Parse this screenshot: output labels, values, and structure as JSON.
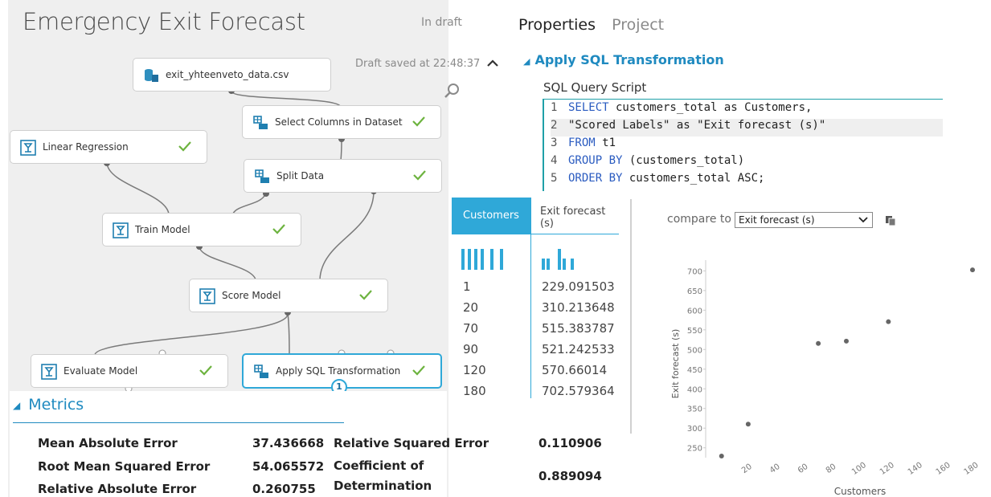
{
  "experiment": {
    "title": "Emergency Exit Forecast",
    "status": "In draft",
    "saved_at": "Draft saved at 22:48:37"
  },
  "nodes": {
    "dataset": {
      "label": "exit_yhteenveto_data.csv"
    },
    "select_columns": {
      "label": "Select Columns in Dataset"
    },
    "linear_regression": {
      "label": "Linear Regression"
    },
    "split_data": {
      "label": "Split Data"
    },
    "train_model": {
      "label": "Train Model"
    },
    "score_model": {
      "label": "Score Model"
    },
    "evaluate_model": {
      "label": "Evaluate Model"
    },
    "apply_sql": {
      "label": "Apply SQL Transformation",
      "badge": "1"
    }
  },
  "metrics": {
    "header": "Metrics",
    "rows_left": [
      {
        "label": "Mean Absolute Error",
        "value": "37.436668"
      },
      {
        "label": "Root Mean Squared Error",
        "value": "54.065572"
      },
      {
        "label": "Relative Absolute Error",
        "value": "0.260755"
      }
    ],
    "rows_right": [
      {
        "label": "Relative Squared Error",
        "value": "0.110906"
      },
      {
        "label_line1": "Coefficient of",
        "label_line2": "Determination",
        "value": "0.889094"
      }
    ]
  },
  "properties": {
    "tab_properties": "Properties",
    "tab_project": "Project",
    "section_title": "Apply SQL Transformation",
    "sql_label": "SQL Query Script",
    "code_lines": [
      {
        "n": "1",
        "kw": "SELECT",
        "rest": " customers_total as Customers,"
      },
      {
        "n": "2",
        "kw": "",
        "rest": "\"Scored Labels\" as \"Exit forecast (s)\""
      },
      {
        "n": "3",
        "kw": "FROM",
        "rest": " t1"
      },
      {
        "n": "4",
        "kw": "GROUP BY",
        "rest": " (customers_total)"
      },
      {
        "n": "5",
        "kw": "ORDER BY",
        "rest": " customers_total ASC;"
      }
    ]
  },
  "results": {
    "col1": "Customers",
    "col2_line1": "Exit forecast",
    "col2_line2": "(s)",
    "rows": [
      [
        "1",
        "229.091503"
      ],
      [
        "20",
        "310.213648"
      ],
      [
        "70",
        "515.383787"
      ],
      [
        "90",
        "521.242533"
      ],
      [
        "120",
        "570.66014"
      ],
      [
        "180",
        "702.579364"
      ]
    ]
  },
  "compare": {
    "label": "compare to",
    "selected": "Exit forecast (s)"
  },
  "chart_data": {
    "type": "scatter",
    "xlabel": "Customers",
    "ylabel": "Exit forecast (s)",
    "x_ticks": [
      "20",
      "40",
      "60",
      "80",
      "100",
      "120",
      "140",
      "160",
      "180"
    ],
    "y_ticks": [
      "250",
      "300",
      "350",
      "400",
      "450",
      "500",
      "550",
      "600",
      "650",
      "700"
    ],
    "xlim": [
      0,
      180
    ],
    "ylim": [
      229,
      715
    ],
    "points": [
      {
        "x": 1,
        "y": 229.091503
      },
      {
        "x": 20,
        "y": 310.213648
      },
      {
        "x": 70,
        "y": 515.383787
      },
      {
        "x": 90,
        "y": 521.242533
      },
      {
        "x": 120,
        "y": 570.66014
      },
      {
        "x": 180,
        "y": 702.579364
      }
    ],
    "point_color": "#666666",
    "grid": false
  },
  "colors": {
    "accent": "#2fa8d8",
    "header_blue": "#1f8ac0",
    "check_green": "#6db33f"
  }
}
